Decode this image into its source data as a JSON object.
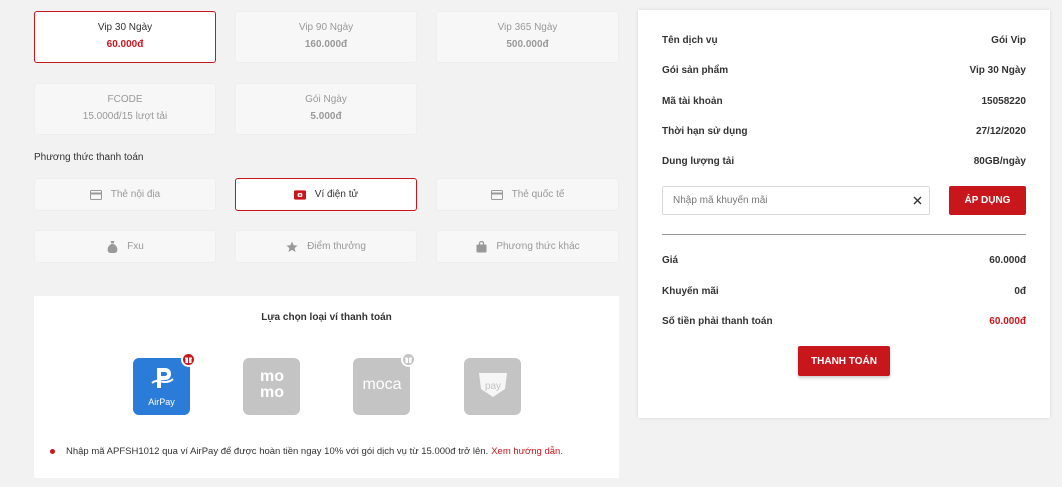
{
  "packages": [
    {
      "name": "Vip 30 Ngày",
      "price": "60.000đ",
      "selected": true
    },
    {
      "name": "Vip 90 Ngày",
      "price": "160.000đ"
    },
    {
      "name": "Vip 365 Ngày",
      "price": "500.000đ"
    },
    {
      "name": "FCODE",
      "price": "15.000đ/15 lượt tải"
    },
    {
      "name": "Gói Ngày",
      "price": "5.000đ"
    }
  ],
  "payment_section_title": "Phương thức thanh toán",
  "payment_methods": [
    {
      "label": "Thẻ nội địa",
      "icon": "card-icon"
    },
    {
      "label": "Ví điện tử",
      "icon": "wallet-icon",
      "selected": true
    },
    {
      "label": "Thẻ quốc tế",
      "icon": "card-icon"
    },
    {
      "label": "Fxu",
      "icon": "money-bag-icon"
    },
    {
      "label": "Điểm thưởng",
      "icon": "star-icon"
    },
    {
      "label": "Phương thức khác",
      "icon": "bag-icon"
    }
  ],
  "wallet_section": {
    "title": "Lựa chọn loại ví thanh toán",
    "wallets": [
      {
        "name": "AirPay",
        "logo": "airpay-logo",
        "color": "#2b7bd9",
        "selected": true,
        "badge": "gift-icon"
      },
      {
        "name": "momo",
        "logo": "momo-logo",
        "color": "#c4c4c4"
      },
      {
        "name": "moca",
        "logo": "moca-logo",
        "color": "#c4c4c4",
        "badge": "gift-icon"
      },
      {
        "name": "pay",
        "logo": "zalopay-logo",
        "color": "#c4c4c4"
      }
    ],
    "note_text": "Nhập mã APFSH1012 qua ví AirPay để được hoàn tiền ngay 10% với gói dịch vụ từ 15.000đ trở lên.",
    "note_link": "Xem hướng dẫn."
  },
  "summary": {
    "rows": [
      {
        "label": "Tên dịch vụ",
        "value": "Gói Vip"
      },
      {
        "label": "Gói sản phẩm",
        "value": "Vip 30 Ngày"
      },
      {
        "label": "Mã tài khoản",
        "value": "15058220"
      },
      {
        "label": "Thời hạn sử dụng",
        "value": "27/12/2020"
      },
      {
        "label": "Dung lượng tải",
        "value": "80GB/ngày"
      }
    ],
    "promo_placeholder": "Nhập mã khuyến mãi",
    "apply_label": "ÁP DỤNG",
    "price_rows": [
      {
        "label": "Giá",
        "value": "60.000đ"
      },
      {
        "label": "Khuyến mãi",
        "value": "0đ"
      },
      {
        "label": "Số tiền phải thanh toán",
        "value": "60.000đ",
        "highlight": true
      }
    ],
    "pay_label": "THANH TOÁN"
  },
  "colors": {
    "accent": "#c8161d",
    "airpay": "#2b7bd9",
    "disabled_logo": "#c4c4c4"
  }
}
